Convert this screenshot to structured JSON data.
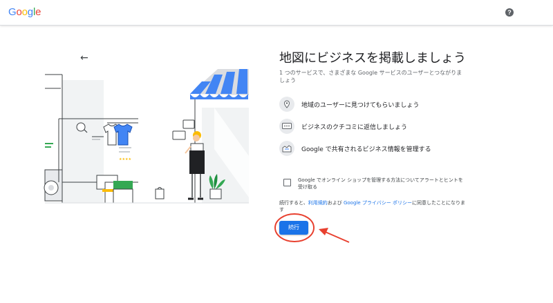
{
  "header": {
    "logo_letters": [
      {
        "ch": "G",
        "color": "#4285F4"
      },
      {
        "ch": "o",
        "color": "#EA4335"
      },
      {
        "ch": "o",
        "color": "#FBBC05"
      },
      {
        "ch": "g",
        "color": "#4285F4"
      },
      {
        "ch": "l",
        "color": "#34A853"
      },
      {
        "ch": "e",
        "color": "#EA4335"
      }
    ],
    "help_glyph": "?"
  },
  "nav": {
    "back_glyph": "←"
  },
  "illustration": {
    "rating_stars": "★★★★"
  },
  "main": {
    "title": "地図にビジネスを掲載しましょう",
    "subtitle": "1 つのサービスで、さまざまな Google サービスのユーザーとつながりましょう",
    "features": [
      {
        "icon": "map-pin-icon",
        "text": "地域のユーザーに見つけてもらいましょう"
      },
      {
        "icon": "review-chat-icon",
        "text": "ビジネスのクチコミに返信しましょう"
      },
      {
        "icon": "business-profile-icon",
        "text": "Google で共有されるビジネス情報を管理する"
      }
    ],
    "checkbox_label": "Google でオンライン ショップを管理する方法についてアラートとヒントを受け取る",
    "terms": {
      "prefix": "続行すると、",
      "terms_link": "利用規約",
      "middle": "および ",
      "privacy_link": "Google プライバシー ポリシー",
      "suffix": "に同意したことになります"
    },
    "continue_label": "続行"
  },
  "colors": {
    "accent": "#1a73e8",
    "annotation": "#e8402f"
  }
}
